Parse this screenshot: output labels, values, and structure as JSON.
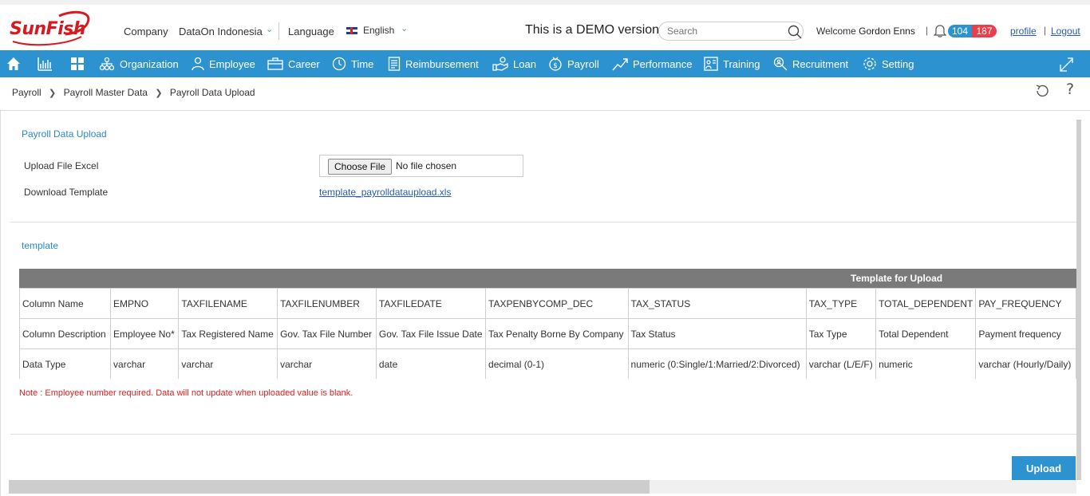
{
  "header": {
    "logo_text": "SunFish",
    "company_label": "Company",
    "company_value": "DataOn Indonesia",
    "language_label": "Language",
    "language_value": "English",
    "demo_text": "This is a DEMO version",
    "search_placeholder": "Search",
    "welcome_prefix": "Welcome",
    "user_name": "Gordon Enns",
    "pipe": "|",
    "notif_blue": "104",
    "notif_red": "187",
    "profile_label": "profile",
    "logout_label": "Logout"
  },
  "nav": {
    "items": [
      {
        "label": "Organization",
        "icon": "organization-icon"
      },
      {
        "label": "Employee",
        "icon": "employee-icon"
      },
      {
        "label": "Career",
        "icon": "briefcase-icon"
      },
      {
        "label": "Time",
        "icon": "clock-icon"
      },
      {
        "label": "Reimbursement",
        "icon": "receipt-icon"
      },
      {
        "label": "Loan",
        "icon": "loan-icon"
      },
      {
        "label": "Payroll",
        "icon": "money-icon"
      },
      {
        "label": "Performance",
        "icon": "chart-line-icon"
      },
      {
        "label": "Training",
        "icon": "training-icon"
      },
      {
        "label": "Recruitment",
        "icon": "search-person-icon"
      },
      {
        "label": "Setting",
        "icon": "gear-icon"
      }
    ]
  },
  "breadcrumb": {
    "items": [
      "Payroll",
      "Payroll Master Data",
      "Payroll Data Upload"
    ]
  },
  "form": {
    "section_title": "Payroll Data Upload",
    "upload_label": "Upload File Excel",
    "choose_file": "Choose File",
    "no_file": "No file chosen",
    "download_label": "Download Template",
    "template_link": "template_payrolldataupload.xls"
  },
  "template": {
    "section_title": "template",
    "table_title": "Template for Upload",
    "rows": [
      [
        "Column Name",
        "EMPNO",
        "TAXFILENAME",
        "TAXFILENUMBER",
        "TAXFILEDATE",
        "TAXPENBYCOMP_DEC",
        "TAX_STATUS",
        "TAX_TYPE",
        "TOTAL_DEPENDENT",
        "PAY_FREQUENCY"
      ],
      [
        "Column Description",
        "Employee No*",
        "Tax Registered Name",
        "Gov. Tax File Number",
        "Gov. Tax File Issue Date",
        "Tax Penalty Borne By Company",
        "Tax Status",
        "Tax Type",
        "Total Dependent",
        "Payment frequency"
      ],
      [
        "Data Type",
        "varchar",
        "varchar",
        "varchar",
        "date",
        "decimal (0-1)",
        "numeric (0:Single/1:Married/2:Divorced)",
        "varchar (L/E/F)",
        "numeric",
        "varchar (Hourly/Daily)"
      ]
    ],
    "note": "Note : Employee number required. Data will not update when uploaded value is blank."
  },
  "actions": {
    "upload_label": "Upload"
  },
  "colors": {
    "brand_blue": "#2d93d0",
    "logo_red": "#d71920",
    "note_red": "#e02020"
  }
}
